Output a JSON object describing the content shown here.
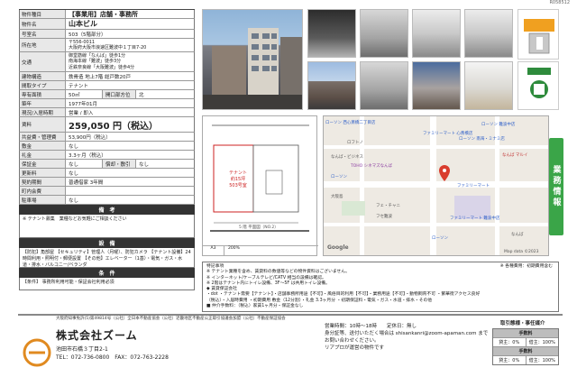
{
  "doc_id": "R058512",
  "property": {
    "rows": [
      {
        "label": "物件種目",
        "value": "【事業用】店舗・事務所"
      },
      {
        "label": "物件名",
        "value": "山本ビル"
      },
      {
        "label": "号室名",
        "value": "503（5階部分）"
      },
      {
        "label": "所在地",
        "value": "〒556-0011\n大阪府大阪市浪速区難波中１丁目7-20"
      },
      {
        "label": "交通",
        "value": "御堂筋線「なんば」徒歩1分\n南海本線「難波」徒歩3分\n近鉄奈良線「大阪難波」徒歩4分"
      },
      {
        "label": "建物構造",
        "value": "鉄骨造 地上7階 総戸数20戸"
      },
      {
        "label": "間取タイプ",
        "value": "テナント"
      }
    ],
    "area_label": "専有面積",
    "area_value": "50㎡",
    "window_label": "開口部方位",
    "window_value": "北",
    "built_label": "築年",
    "built_value": "1977年01月",
    "status_label": "現況/入居時期",
    "status_value": "営業 / 即入",
    "rent_label": "賃料",
    "rent_value": "259,050 円（税込）",
    "common_label": "共益費・管理費",
    "common_value": "53,900円（税込）",
    "deposit_label": "敷金",
    "deposit_value": "なし",
    "key_label": "礼金",
    "key_value": "3.3ヶ月（税込）",
    "guarantee_label": "保証金",
    "guarantee_value": "なし",
    "kickback_label": "償却・敷引",
    "kickback_value": "なし",
    "renewal_label": "更新料",
    "renewal_value": "なし",
    "contract_label": "契約期間",
    "contract_value": "普通借家 3年間",
    "town_label": "町内会費",
    "town_value": "",
    "parking_label": "駐車場",
    "parking_value": "なし"
  },
  "notes_title": "備　考",
  "notes_text": "※ テナント募集　業種などお気軽にご相談ください",
  "equip_title": "設　備",
  "equip_text": "【防犯】角部屋 【セキュリティ】管理人（月曜）、防犯カメラ 【テナント設備】24時間利用・照明付・郵便設置 【その他】エレベーター（1基）・電気・ガス・水道・排水・バルコニー/ベランダ",
  "cond_title": "条　件",
  "cond_text": "【条件】 事務所利用可能・保証会社利用必須",
  "plan": {
    "tenant_label": "テナント",
    "tenant_area": "約15坪",
    "tenant_unit": "503号室",
    "bottom_label": "5 階 平面図（NO.2）",
    "scale_labels": [
      "A3",
      "200%"
    ]
  },
  "map": {
    "labels": [
      "ローソン 西心斎橋二丁目店",
      "ファミリーマート 心斎橋店",
      "ローソン 難波中店",
      "ロフトノ",
      "なんば・ビジネス",
      "TOHO シネマズなんば",
      "ローソン",
      "大阪島",
      "フェ・チャニ",
      "フセ難波",
      "ローソン 南海・ミナミ店",
      "ファミリーマート",
      "なんば マルイ",
      "ファミリーマート 難波中店",
      "Google",
      "なんば",
      "ローソン"
    ],
    "footer": "Map data ©2023"
  },
  "side_tab": "業務情報",
  "remarks": {
    "title": "特記事項",
    "lines": [
      "※ テナント業種を含め、賃貸料の数値等などの物件資料はございません。",
      "※ インターネット/ケーブルテレビ/CATV 相当の設備は確認。",
      "※ 2階はテナント内にトイレ設備、3F～5F は共用トイレ設備。",
      "◆ 賃貸保証会社",
      "・dot ・テナント需要【テナント】・店舗事務所用途【不可】・風俗目的利用【不可】・業務用途【不可】・動物飼育不可 ・繁華街アクセス良好",
      "（税込）・入居時費用 ・初期費用 敷金（12分割）・礼金 3.3ヶ月分 ・初期保証料・電気・ガス・水道・排水・その他",
      "■ 入居日相談可（即入居可）"
    ],
    "right_note": "※ 各種費用：初期費用含む",
    "bottom": "■ 仲介手数料：（税込）家賃1ヶ月分・保証金なし"
  },
  "footer": {
    "license": "大阪府知事免許(5)第49814号（公社）全日本不動産協会（公社）近畿地区不動産公正取引協議会加盟（公社）不動産保証協会",
    "company": "株式会社ズーム",
    "address": "池田市石橋３丁目2-1",
    "tel": "TEL：072-736-0800　FAX：072-763-2228",
    "hours": "営業時間：10時～18時　　定休日：無し",
    "hours2": "身分証等、送付いただく場合は shisankanri@zoom-apaman.com まで",
    "hours3": "お問い合わせください。",
    "hours4": "リアプロが運営の物件です",
    "fee_title": "取引態様・事任媒介",
    "fee_header": "手数料",
    "fee_sub": "手数料",
    "fee_row1": [
      "貸主：0%",
      "借主：100%"
    ],
    "fee_row2": [
      "貸主：0%",
      "借主：100%"
    ]
  }
}
